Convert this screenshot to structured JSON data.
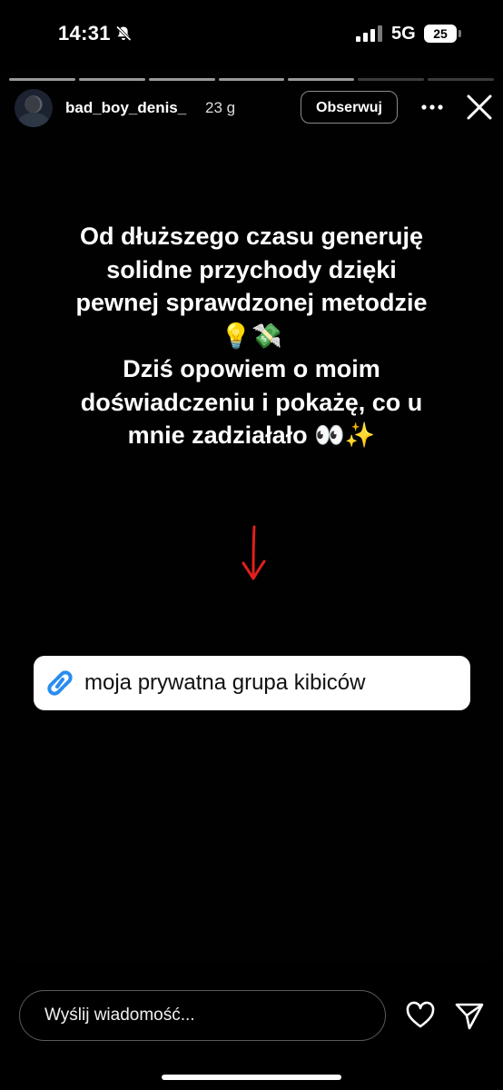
{
  "status_bar": {
    "time": "14:31",
    "network": "5G",
    "battery": "25",
    "icons": [
      "bell-slash-icon",
      "signal-icon"
    ]
  },
  "story": {
    "progress": {
      "segments": 7,
      "completed": 5
    },
    "user": {
      "username": "bad_boy_denis_",
      "time_ago": "23 g",
      "follow_label": "Obserwuj"
    },
    "text_lines": [
      "Od dłuższego czasu generuję",
      "solidne przychody dzięki",
      "pewnej sprawdzonej metodzie",
      "💡💸",
      "Dziś opowiem o moim",
      "doświadczeniu i pokażę, co u",
      "mnie zadziałało 👀✨"
    ],
    "arrow_color": "#e0201c",
    "link_sticker": {
      "text": "moja prywatna grupa kibiców",
      "icon": "link-icon",
      "icon_color": "#2a8cf0"
    }
  },
  "reply_bar": {
    "placeholder": "Wyślij wiadomość...",
    "icons": [
      "heart-icon",
      "send-icon"
    ]
  }
}
